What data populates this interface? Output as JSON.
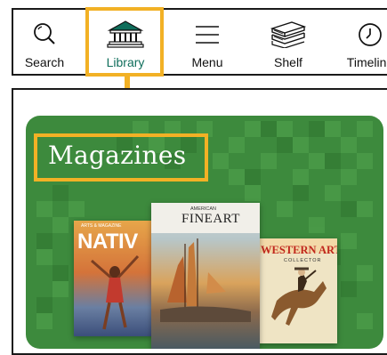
{
  "nav": {
    "items": [
      {
        "label": "Search",
        "icon": "search-icon"
      },
      {
        "label": "Library",
        "icon": "library-icon",
        "active": true
      },
      {
        "label": "Menu",
        "icon": "menu-icon"
      },
      {
        "label": "Shelf",
        "icon": "shelf-icon"
      },
      {
        "label": "Timeline",
        "icon": "clock-icon"
      }
    ],
    "highlight_color": "#f2b125",
    "active_color": "#0f6e5b"
  },
  "card": {
    "title": "Magazines",
    "background_color": "#3d8a3d",
    "covers": [
      {
        "title": "NATIV",
        "kicker": "ARTS & MAGAZINE"
      },
      {
        "title": "FINEART",
        "kicker": "AMERICAN"
      },
      {
        "title": "WESTERN ART",
        "kicker": "COLLECTOR"
      }
    ]
  }
}
